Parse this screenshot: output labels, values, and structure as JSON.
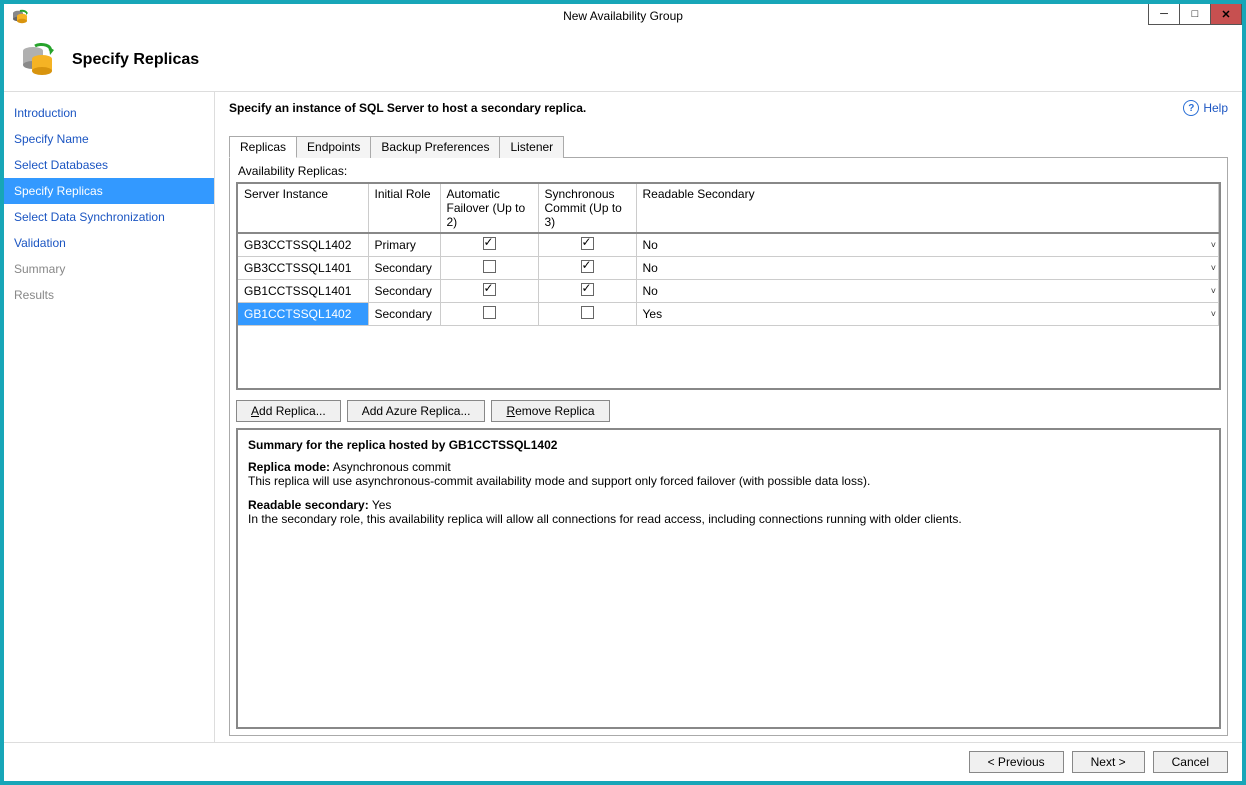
{
  "window": {
    "title": "New Availability Group"
  },
  "header": {
    "title": "Specify Replicas"
  },
  "nav": {
    "items": [
      {
        "label": "Introduction",
        "state": "link"
      },
      {
        "label": "Specify Name",
        "state": "link"
      },
      {
        "label": "Select Databases",
        "state": "link"
      },
      {
        "label": "Specify Replicas",
        "state": "selected"
      },
      {
        "label": "Select Data Synchronization",
        "state": "link"
      },
      {
        "label": "Validation",
        "state": "link"
      },
      {
        "label": "Summary",
        "state": "disabled"
      },
      {
        "label": "Results",
        "state": "disabled"
      }
    ]
  },
  "content": {
    "instruction": "Specify an instance of SQL Server to host a secondary replica.",
    "help_label": "Help",
    "tabs": [
      {
        "label": "Replicas",
        "active": true
      },
      {
        "label": "Endpoints",
        "active": false
      },
      {
        "label": "Backup Preferences",
        "active": false
      },
      {
        "label": "Listener",
        "active": false
      }
    ],
    "section_label": "Availability Replicas:",
    "columns": {
      "server_instance": "Server Instance",
      "initial_role": "Initial Role",
      "auto_failover": "Automatic Failover (Up to 2)",
      "sync_commit": "Synchronous Commit (Up to 3)",
      "readable_secondary": "Readable Secondary"
    },
    "rows": [
      {
        "server_instance": "GB3CCTSSQL1402",
        "initial_role": "Primary",
        "auto_failover": true,
        "sync_commit": true,
        "readable_secondary": "No",
        "selected": false
      },
      {
        "server_instance": "GB3CCTSSQL1401",
        "initial_role": "Secondary",
        "auto_failover": false,
        "sync_commit": true,
        "readable_secondary": "No",
        "selected": false
      },
      {
        "server_instance": "GB1CCTSSQL1401",
        "initial_role": "Secondary",
        "auto_failover": true,
        "sync_commit": true,
        "readable_secondary": "No",
        "selected": false
      },
      {
        "server_instance": "GB1CCTSSQL1402",
        "initial_role": "Secondary",
        "auto_failover": false,
        "sync_commit": false,
        "readable_secondary": "Yes",
        "selected": true
      }
    ],
    "buttons": {
      "add_replica": "Add Replica...",
      "add_azure_replica": "Add Azure Replica...",
      "remove_replica": "Remove Replica"
    },
    "summary": {
      "heading": "Summary for the replica hosted by GB1CCTSSQL1402",
      "replica_mode_label": "Replica mode:",
      "replica_mode_value": "Asynchronous commit",
      "replica_mode_desc": "This replica will use asynchronous-commit availability mode and support only forced failover (with possible data loss).",
      "readable_secondary_label": "Readable secondary:",
      "readable_secondary_value": "Yes",
      "readable_secondary_desc": "In the secondary role, this availability replica will allow all connections for read access, including connections running with older clients."
    }
  },
  "footer": {
    "previous": "< Previous",
    "next": "Next >",
    "cancel": "Cancel"
  }
}
